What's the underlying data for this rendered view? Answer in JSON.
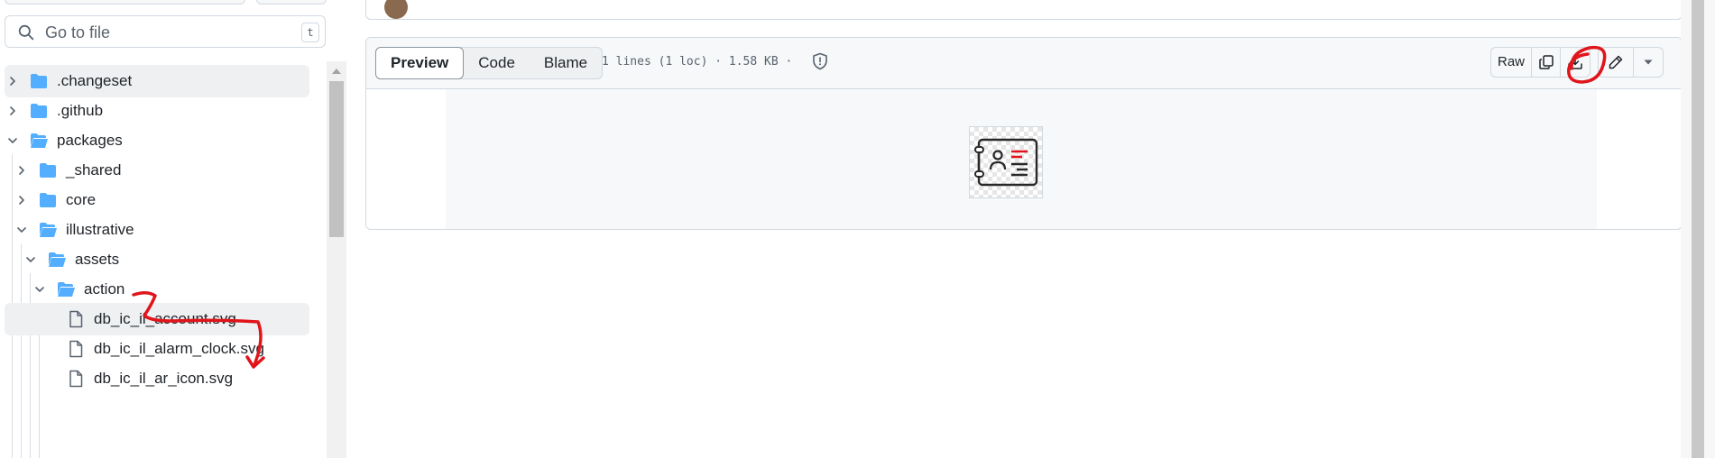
{
  "sidebar": {
    "search": {
      "placeholder": "Go to file",
      "shortcut": "t"
    },
    "tree": [
      {
        "label": ".changeset",
        "type": "folder",
        "expanded": false,
        "selected": true
      },
      {
        "label": ".github",
        "type": "folder",
        "expanded": false
      },
      {
        "label": "packages",
        "type": "folder",
        "expanded": true
      },
      {
        "label": "_shared",
        "type": "folder",
        "expanded": false
      },
      {
        "label": "core",
        "type": "folder",
        "expanded": false
      },
      {
        "label": "illustrative",
        "type": "folder",
        "expanded": true
      },
      {
        "label": "assets",
        "type": "folder",
        "expanded": true
      },
      {
        "label": "action",
        "type": "folder",
        "expanded": true
      },
      {
        "label": "db_ic_il_account.svg",
        "type": "file",
        "selected": true
      },
      {
        "label": "db_ic_il_alarm_clock.svg",
        "type": "file"
      },
      {
        "label": "db_ic_il_ar_icon.svg",
        "type": "file"
      }
    ]
  },
  "file_view": {
    "tabs": [
      {
        "label": "Preview",
        "active": true
      },
      {
        "label": "Code",
        "active": false
      },
      {
        "label": "Blame",
        "active": false
      }
    ],
    "meta": "1 lines (1 loc) · 1.58 KB ·",
    "raw_label": "Raw",
    "actions": [
      "copy-raw-icon",
      "download-icon",
      "pencil-icon",
      "triangle-down-icon"
    ]
  },
  "colors": {
    "folder": "#54aeff",
    "annotation": "#e0151b",
    "accent_border": "#d1d9e0",
    "selected_row": "#eef0f2"
  }
}
